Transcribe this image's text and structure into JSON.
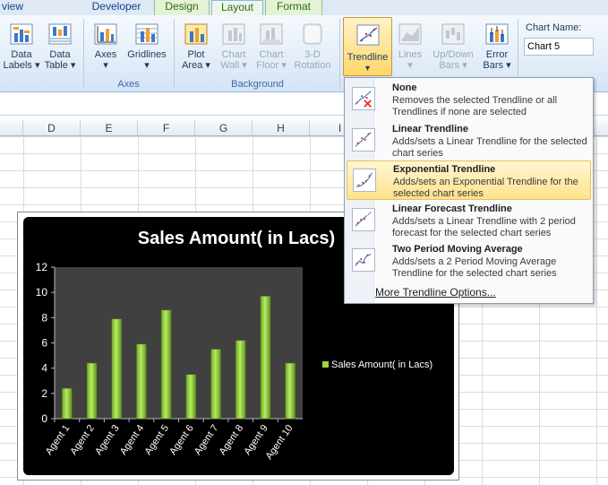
{
  "tabs": [
    "view",
    "Developer",
    "Design",
    "Layout",
    "Format"
  ],
  "ribbon": {
    "buttons": {
      "data_labels": [
        "Data",
        "Labels"
      ],
      "data_table": [
        "Data",
        "Table"
      ],
      "axes": "Axes",
      "gridlines": "Gridlines",
      "plot_area": [
        "Plot",
        "Area"
      ],
      "chart_wall": [
        "Chart",
        "Wall"
      ],
      "chart_floor": [
        "Chart",
        "Floor"
      ],
      "rotation": [
        "3-D",
        "Rotation"
      ],
      "trendline": "Trendline",
      "lines": "Lines",
      "updown_bars": [
        "Up/Down",
        "Bars"
      ],
      "error_bars": [
        "Error",
        "Bars"
      ]
    },
    "groups": {
      "axes": "Axes",
      "background": "Background"
    },
    "chart_name_label": "Chart Name:",
    "chart_name_value": "Chart 5"
  },
  "columns": [
    "D",
    "E",
    "F",
    "G",
    "H",
    "I"
  ],
  "trendline_menu": {
    "items": [
      {
        "title": "None",
        "desc": "Removes the selected Trendline or all Trendlines if none are selected",
        "icon": "trendline-none-icon"
      },
      {
        "title": "Linear Trendline",
        "desc": "Adds/sets a Linear Trendline for the selected chart series",
        "icon": "linear-trendline-icon"
      },
      {
        "title": "Exponential Trendline",
        "desc": "Adds/sets an Exponential Trendline for the selected chart series",
        "icon": "exponential-trendline-icon"
      },
      {
        "title": "Linear Forecast Trendline",
        "desc": "Adds/sets a Linear Trendline with 2 period forecast for the selected chart series",
        "icon": "linear-forecast-trendline-icon"
      },
      {
        "title": "Two Period Moving Average",
        "desc": "Adds/sets a 2 Period Moving Average Trendline for the selected chart series",
        "icon": "moving-average-trendline-icon"
      }
    ],
    "highlighted_index": 2,
    "more_options": "More Trendline Options..."
  },
  "chart_data": {
    "type": "bar",
    "title": "Sales Amount( in Lacs)",
    "categories": [
      "Agent 1",
      "Agent 2",
      "Agent 3",
      "Agent 4",
      "Agent 5",
      "Agent 6",
      "Agent 7",
      "Agent 8",
      "Agent 9",
      "Agent 10"
    ],
    "series": [
      {
        "name": "Sales Amount( in Lacs)",
        "values": [
          2.4,
          4.4,
          7.9,
          5.9,
          8.6,
          3.5,
          5.5,
          6.2,
          9.7,
          4.4
        ]
      }
    ],
    "ylim": [
      0,
      12
    ],
    "yticks": [
      0,
      2,
      4,
      6,
      8,
      10,
      12
    ],
    "legend": "right",
    "grid": false,
    "colors": {
      "bar": "#9bd840",
      "plot_bg": "#404040",
      "chart_bg": "#000000"
    }
  }
}
